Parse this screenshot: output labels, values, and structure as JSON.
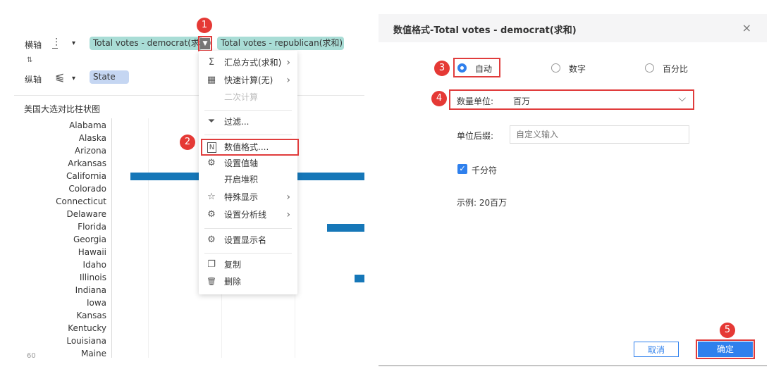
{
  "left": {
    "x_axis": {
      "label": "横轴",
      "fields": [
        "Total votes - democrat(求和)",
        "Total votes - republican(求和)"
      ]
    },
    "y_axis": {
      "label": "纵轴",
      "fields": [
        "State"
      ]
    },
    "chart_title": "美国大选对比柱状图",
    "states": [
      "Alabama",
      "Alaska",
      "Arizona",
      "Arkansas",
      "California",
      "Colorado",
      "Connecticut",
      "Delaware",
      "Florida",
      "Georgia",
      "Hawaii",
      "Idaho",
      "Illinois",
      "Indiana",
      "Iowa",
      "Kansas",
      "Kentucky",
      "Louisiana",
      "Maine"
    ],
    "corner_text": "60",
    "bar_color": "#1677b8"
  },
  "menu": {
    "items": [
      {
        "icon": "sigma-icon",
        "glyph": "Σ",
        "label": "汇总方式(求和)",
        "arrow": "›"
      },
      {
        "icon": "quick-calc-icon",
        "glyph": "▦",
        "label": "快速计算(无)",
        "arrow": "›"
      },
      {
        "icon": "",
        "glyph": "",
        "label": "二次计算",
        "arrow": ""
      },
      {
        "icon": "filter-icon",
        "glyph": "⏷",
        "label": "过滤...",
        "arrow": ""
      },
      {
        "icon": "number-format-icon",
        "glyph": "N",
        "label": "数值格式....",
        "arrow": ""
      },
      {
        "icon": "gear-icon",
        "glyph": "⚙",
        "label": "设置值轴",
        "arrow": ""
      },
      {
        "icon": "",
        "glyph": "",
        "label": "开启堆积",
        "arrow": ""
      },
      {
        "icon": "star-icon",
        "glyph": "☆",
        "label": "特殊显示",
        "arrow": "›"
      },
      {
        "icon": "gear-icon",
        "glyph": "⚙",
        "label": "设置分析线",
        "arrow": "›"
      },
      {
        "icon": "gear-icon",
        "glyph": "⚙",
        "label": "设置显示名",
        "arrow": ""
      },
      {
        "icon": "copy-icon",
        "glyph": "❐",
        "label": "复制",
        "arrow": ""
      },
      {
        "icon": "trash-icon",
        "glyph": "🗑",
        "label": "删除",
        "arrow": ""
      }
    ]
  },
  "dialog": {
    "title": "数值格式-Total votes - democrat(求和)",
    "close_icon": "×",
    "radio_options": [
      "自动",
      "数字",
      "百分比"
    ],
    "selected_option": "自动",
    "unit_label": "数量单位:",
    "unit_value": "百万",
    "suffix_label": "单位后缀:",
    "suffix_placeholder": "自定义输入",
    "thousands_label": "千分符",
    "thousands_checked": true,
    "example": "示例: 20百万",
    "cancel_label": "取消",
    "ok_label": "确定",
    "accent_color": "#2f80ed"
  },
  "annotations": [
    "1",
    "2",
    "3",
    "4",
    "5"
  ]
}
